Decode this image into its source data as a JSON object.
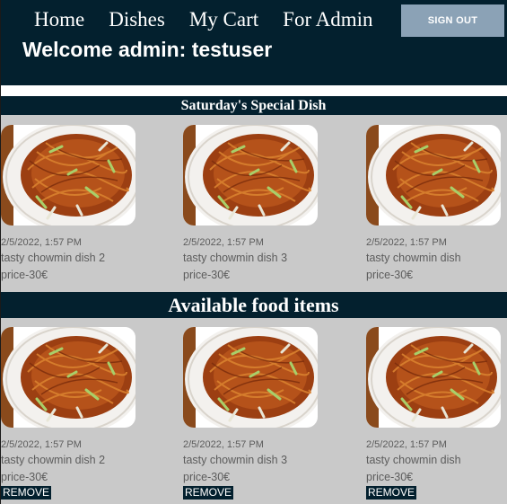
{
  "nav": {
    "links": [
      "Home",
      "Dishes",
      "My Cart",
      "For Admin"
    ],
    "signout_label": "SIGN OUT",
    "welcome": "Welcome admin: testuser"
  },
  "special_section": {
    "title": "Saturday's Special Dish",
    "items": [
      {
        "date": "2/5/2022, 1:57 PM",
        "name": "tasty chowmin dish 2",
        "price": "price-30€"
      },
      {
        "date": "2/5/2022, 1:57 PM",
        "name": "tasty chowmin dish 3",
        "price": "price-30€"
      },
      {
        "date": "2/5/2022, 1:57 PM",
        "name": "tasty chowmin dish",
        "price": "price-30€"
      }
    ]
  },
  "available_section": {
    "title": "Available food items",
    "remove_label": "REMOVE",
    "items": [
      {
        "date": "2/5/2022, 1:57 PM",
        "name": "tasty chowmin dish 2",
        "price": "price-30€"
      },
      {
        "date": "2/5/2022, 1:57 PM",
        "name": "tasty chowmin dish 3",
        "price": "price-30€"
      },
      {
        "date": "2/5/2022, 1:57 PM",
        "name": "tasty chowmin dish",
        "price": "price-30€"
      }
    ]
  },
  "colors": {
    "navbar": "#03202e",
    "background": "#c9c9c9",
    "signout_button": "#8ba2b6",
    "text_muted": "#5c5c5c"
  }
}
